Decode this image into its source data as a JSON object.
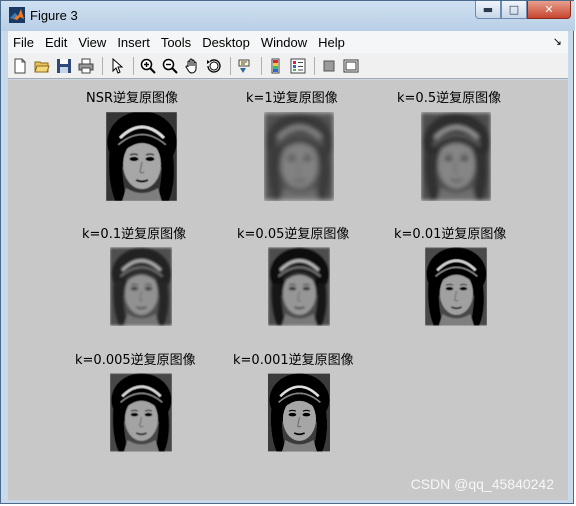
{
  "window": {
    "title": "Figure 3",
    "buttons": {
      "minimize": "▬",
      "maximize": "□",
      "close": "✕"
    }
  },
  "menu": [
    "File",
    "Edit",
    "View",
    "Insert",
    "Tools",
    "Desktop",
    "Window",
    "Help"
  ],
  "menu_arrow": "↘",
  "toolbar": [
    "new-figure-icon",
    "open-file-icon",
    "save-icon",
    "print-icon",
    "edit-plot-arrow-icon",
    "zoom-in-icon",
    "zoom-out-icon",
    "pan-hand-icon",
    "rotate-3d-icon",
    "data-cursor-icon",
    "colorbar-icon",
    "legend-icon",
    "hide-plot-tools-icon",
    "show-plot-tools-icon"
  ],
  "subplots": [
    {
      "title": "NSR逆复原图像",
      "blur": 0.4,
      "brightness": 0.92,
      "contrast": 1.35
    },
    {
      "title": "k=1逆复原图像",
      "blur": 2.6,
      "brightness": 0.55,
      "contrast": 0.9
    },
    {
      "title": "k=0.5逆复原图像",
      "blur": 2.2,
      "brightness": 0.6,
      "contrast": 0.95
    },
    {
      "title": "k=0.1逆复原图像",
      "blur": 1.5,
      "brightness": 0.72,
      "contrast": 1.0
    },
    {
      "title": "k=0.05逆复原图像",
      "blur": 1.2,
      "brightness": 0.78,
      "contrast": 1.05
    },
    {
      "title": "k=0.01逆复原图像",
      "blur": 0.7,
      "brightness": 0.88,
      "contrast": 1.15
    },
    {
      "title": "k=0.005逆复原图像",
      "blur": 0.55,
      "brightness": 0.9,
      "contrast": 1.2
    },
    {
      "title": "k=0.001逆复原图像",
      "blur": 0.45,
      "brightness": 0.92,
      "contrast": 1.3
    }
  ],
  "watermark": "CSDN @qq_45840242"
}
